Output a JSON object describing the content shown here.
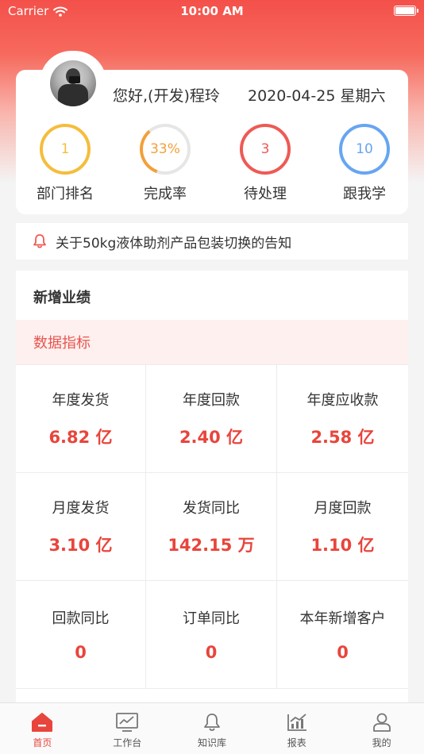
{
  "status_bar": {
    "carrier": "Carrier",
    "time": "10:00 AM"
  },
  "profile": {
    "greeting": "您好,(开发)程玲",
    "date": "2020-04-25 星期六"
  },
  "stats": [
    {
      "value": "1",
      "label": "部门排名",
      "color": "#f5bd3c"
    },
    {
      "value": "33%",
      "label": "完成率",
      "color": "#f2a03a",
      "progress": 0.33
    },
    {
      "value": "3",
      "label": "待处理",
      "color": "#ee5a55"
    },
    {
      "value": "10",
      "label": "跟我学",
      "color": "#67a5f2"
    }
  ],
  "notice": {
    "text": "关于50kg液体助剂产品包装切换的告知",
    "icon": "bell-icon"
  },
  "performance": {
    "title": "新增业绩",
    "subtitle": "数据指标",
    "metrics": [
      {
        "label": "年度发货",
        "value": "6.82 亿"
      },
      {
        "label": "年度回款",
        "value": "2.40 亿"
      },
      {
        "label": "年度应收款",
        "value": "2.58 亿"
      },
      {
        "label": "月度发货",
        "value": "3.10 亿"
      },
      {
        "label": "发货同比",
        "value": "142.15 万"
      },
      {
        "label": "月度回款",
        "value": "1.10 亿"
      },
      {
        "label": "回款同比",
        "value": "0"
      },
      {
        "label": "订单同比",
        "value": "0"
      },
      {
        "label": "本年新增客户",
        "value": "0"
      }
    ]
  },
  "tabs": [
    {
      "label": "首页",
      "icon": "home-icon",
      "active": true
    },
    {
      "label": "工作台",
      "icon": "workbench-icon",
      "active": false
    },
    {
      "label": "知识库",
      "icon": "bell-icon",
      "active": false
    },
    {
      "label": "报表",
      "icon": "report-icon",
      "active": false
    },
    {
      "label": "我的",
      "icon": "profile-icon",
      "active": false
    }
  ],
  "colors": {
    "accent": "#e8453c",
    "header_red": "#f4504a"
  }
}
